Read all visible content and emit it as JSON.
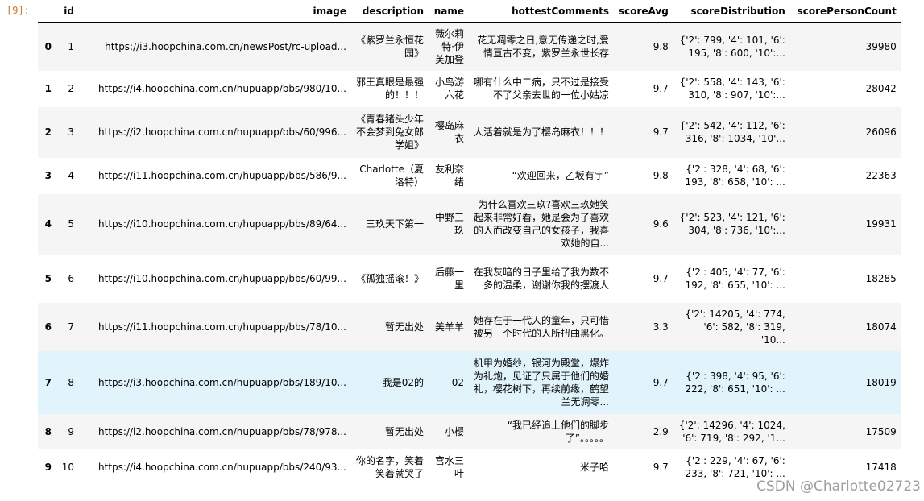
{
  "prompt": "[9]:",
  "columns": [
    "",
    "id",
    "image",
    "description",
    "name",
    "hottestComments",
    "scoreAvg",
    "scoreDistribution",
    "scorePersonCount"
  ],
  "rows": [
    {
      "index": "0",
      "id": "1",
      "image": "https://i3.hoopchina.com.cn/newsPost/rc-upload...",
      "description": "《紫罗兰永恒花园》",
      "name": "薇尔莉特·伊芙加登",
      "hottestComments": "花无凋零之日,意无传递之时,爱情亘古不变，紫罗兰永世长存",
      "scoreAvg": "9.8",
      "scoreDistribution": "{'2': 799, '4': 101, '6': 195, '8': 600, '10':...",
      "scorePersonCount": "39980"
    },
    {
      "index": "1",
      "id": "2",
      "image": "https://i4.hoopchina.com.cn/hupuapp/bbs/980/10...",
      "description": "邪王真眼是最强的！！！",
      "name": "小鸟游六花",
      "hottestComments": "哪有什么中二病，只不过是接受不了父亲去世的一位小姑凉",
      "scoreAvg": "9.7",
      "scoreDistribution": "{'2': 558, '4': 143, '6': 310, '8': 907, '10':...",
      "scorePersonCount": "28042"
    },
    {
      "index": "2",
      "id": "3",
      "image": "https://i2.hoopchina.com.cn/hupuapp/bbs/60/996...",
      "description": "《青春猪头少年不会梦到兔女郎学姐》",
      "name": "樱岛麻衣",
      "hottestComments": "人活着就是为了樱岛麻衣！！！",
      "scoreAvg": "9.7",
      "scoreDistribution": "{'2': 542, '4': 112, '6': 316, '8': 1034, '10'...",
      "scorePersonCount": "26096"
    },
    {
      "index": "3",
      "id": "4",
      "image": "https://i11.hoopchina.com.cn/hupuapp/bbs/586/9...",
      "description": "Charlotte（夏洛特）",
      "name": "友利奈绪",
      "hottestComments": "“欢迎回来，乙坂有宇”",
      "scoreAvg": "9.8",
      "scoreDistribution": "{'2': 328, '4': 68, '6': 193, '8': 658, '10': ...",
      "scorePersonCount": "22363"
    },
    {
      "index": "4",
      "id": "5",
      "image": "https://i10.hoopchina.com.cn/hupuapp/bbs/89/64...",
      "description": "三玖天下第一",
      "name": "中野三玖",
      "hottestComments": "为什么喜欢三玖?喜欢三玖她笑起来非常好看，她是会为了喜欢的人而改变自己的女孩子，我喜欢她的自...",
      "scoreAvg": "9.6",
      "scoreDistribution": "{'2': 523, '4': 121, '6': 304, '8': 736, '10':...",
      "scorePersonCount": "19931"
    },
    {
      "index": "5",
      "id": "6",
      "image": "https://i10.hoopchina.com.cn/hupuapp/bbs/60/99...",
      "description": "《孤独摇滚！》",
      "name": "后藤一里",
      "hottestComments": "在我灰暗的日子里给了我为数不多的温柔，谢谢你我的摆渡人",
      "scoreAvg": "9.7",
      "scoreDistribution": "{'2': 405, '4': 77, '6': 192, '8': 655, '10': ...",
      "scorePersonCount": "18285"
    },
    {
      "index": "6",
      "id": "7",
      "image": "https://i11.hoopchina.com.cn/hupuapp/bbs/78/10...",
      "description": "暂无出处",
      "name": "美羊羊",
      "hottestComments": "她存在于一代人的童年，只可惜被另一个时代的人所扭曲黑化。",
      "scoreAvg": "3.3",
      "scoreDistribution": "{'2': 14205, '4': 774, '6': 582, '8': 319, '10...",
      "scorePersonCount": "18074"
    },
    {
      "index": "7",
      "id": "8",
      "image": "https://i3.hoopchina.com.cn/hupuapp/bbs/189/10...",
      "description": "我是02的",
      "name": "02",
      "hottestComments": "机甲为婚纱，银河为殿堂，爆炸为礼炮，见证了只属于他们的婚礼，樱花树下，再续前缘，鹤望兰无凋零...",
      "scoreAvg": "9.7",
      "scoreDistribution": "{'2': 398, '4': 95, '6': 222, '8': 651, '10': ...",
      "scorePersonCount": "18019"
    },
    {
      "index": "8",
      "id": "9",
      "image": "https://i2.hoopchina.com.cn/hupuapp/bbs/78/978...",
      "description": "暂无出处",
      "name": "小樱",
      "hottestComments": "“我已经追上他们的脚步了”。。。。。",
      "scoreAvg": "2.9",
      "scoreDistribution": "{'2': 14296, '4': 1024, '6': 719, '8': 292, '1...",
      "scorePersonCount": "17509"
    },
    {
      "index": "9",
      "id": "10",
      "image": "https://i4.hoopchina.com.cn/hupuapp/bbs/240/93...",
      "description": "你的名字，笑着笑着就哭了",
      "name": "宫水三叶",
      "hottestComments": "米子哈",
      "scoreAvg": "9.7",
      "scoreDistribution": "{'2': 229, '4': 67, '6': 233, '8': 721, '10': ...",
      "scorePersonCount": "17418"
    }
  ],
  "highlighted_row": 7,
  "watermark": "CSDN @Charlotte02723"
}
